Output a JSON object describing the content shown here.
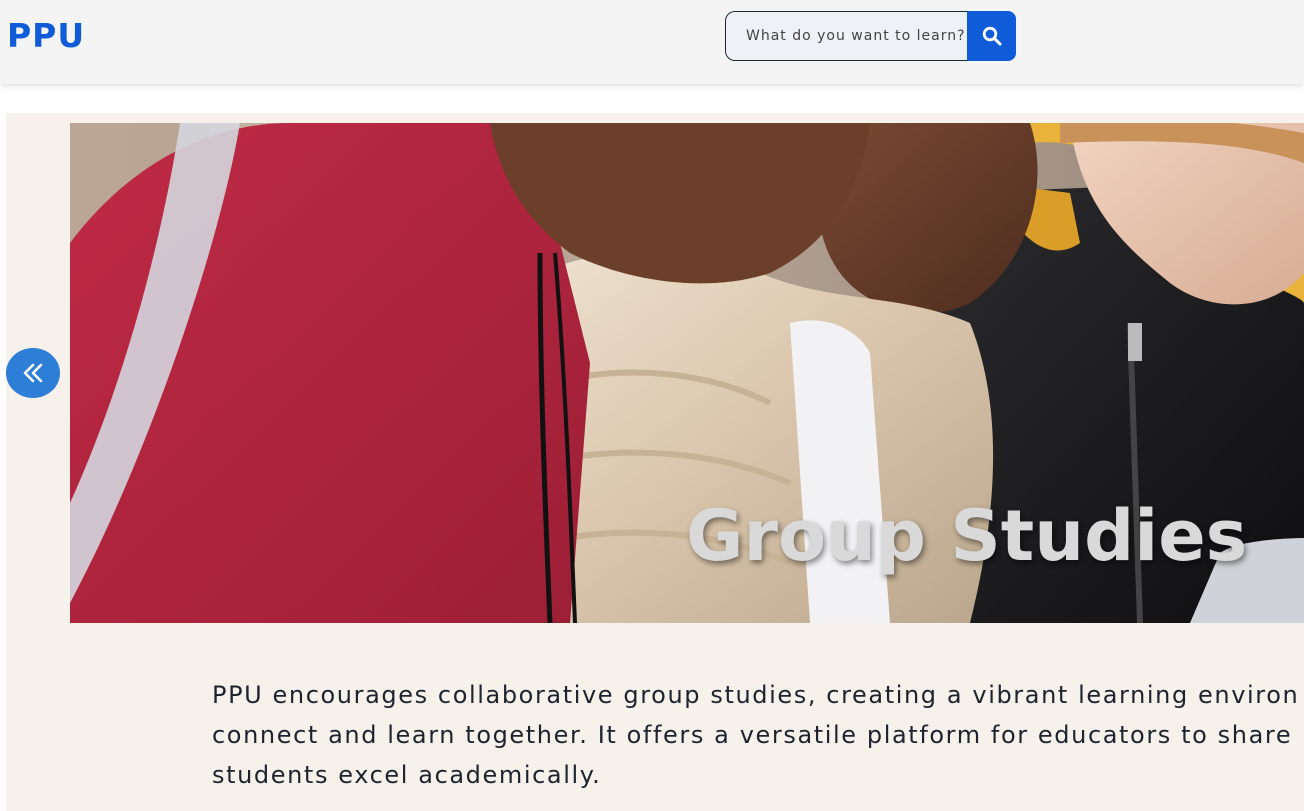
{
  "header": {
    "logo": "PPU",
    "search": {
      "placeholder": "What do you want to learn?",
      "button_icon": "search-icon"
    }
  },
  "carousel": {
    "prev_icon": "double-chevron-left-icon",
    "slide": {
      "title": "Group Studies",
      "description_lines": [
        "PPU encourages collaborative group studies, creating a vibrant learning environ",
        "connect and learn together. It offers a versatile platform for educators to share",
        "students excel academically."
      ]
    }
  },
  "colors": {
    "brand": "#0f5bd8",
    "carousel_button": "#2d7ed6",
    "content_background": "#f6f1ea",
    "header_background": "#f4f4f4"
  }
}
